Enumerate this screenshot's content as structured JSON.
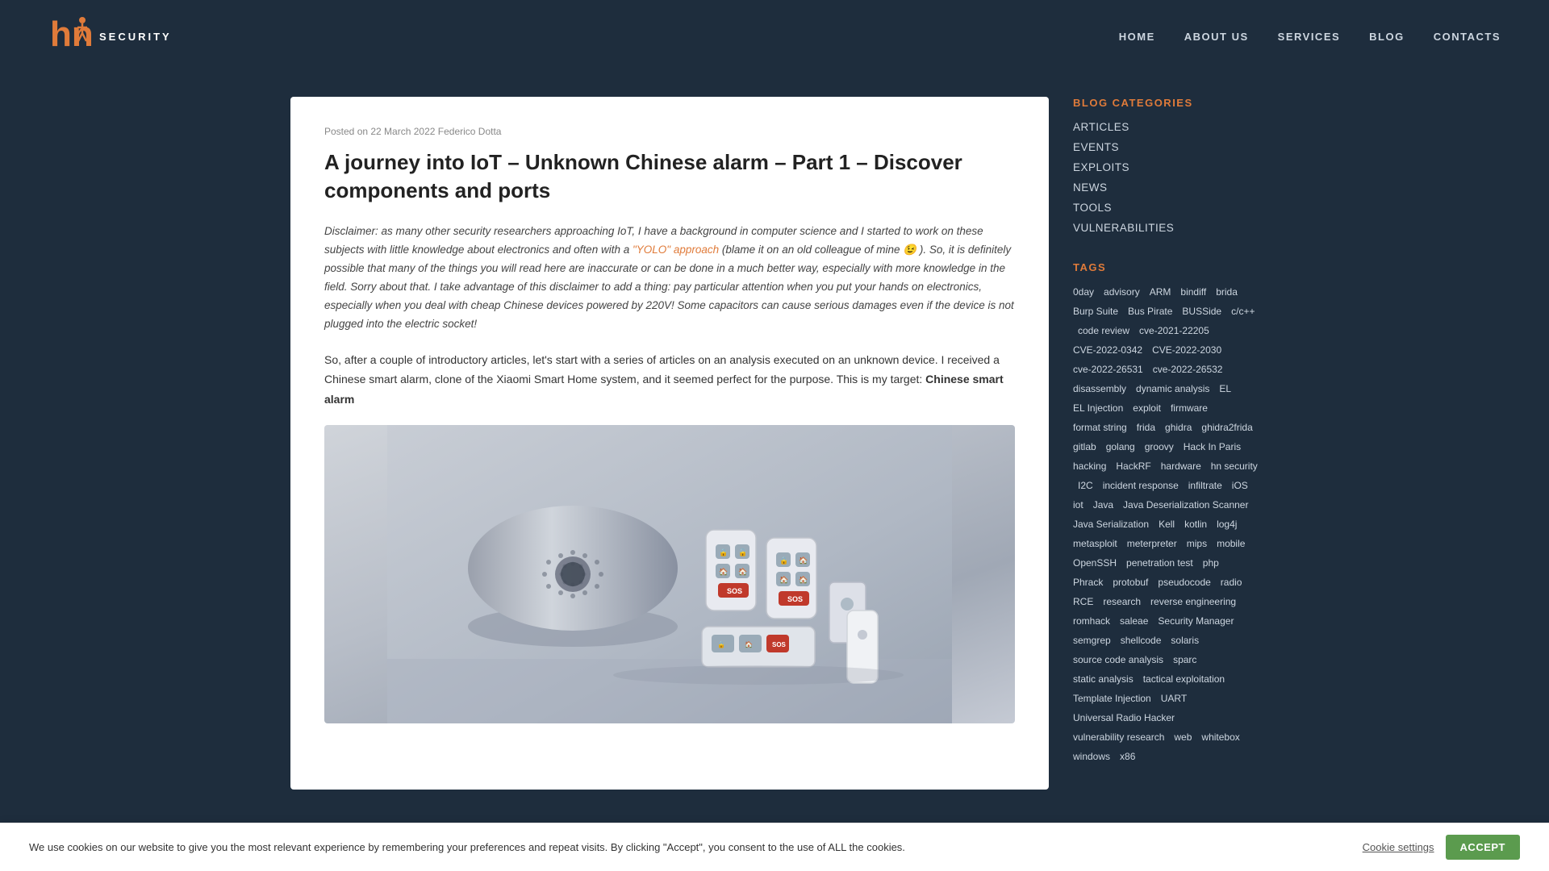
{
  "header": {
    "logo_text": "SECURITY",
    "nav": [
      {
        "label": "HOME",
        "href": "#"
      },
      {
        "label": "ABOUT US",
        "href": "#"
      },
      {
        "label": "SERVICES",
        "href": "#"
      },
      {
        "label": "BLOG",
        "href": "#"
      },
      {
        "label": "CONTACTS",
        "href": "#"
      }
    ]
  },
  "article": {
    "meta": "Posted on 22 March 2022 Federico Dotta",
    "title": "A journey into IoT – Unknown Chinese alarm – Part 1 – Discover components and ports",
    "disclaimer": "Disclaimer: as many other security researchers approaching IoT, I have a background in computer science and I started to work on these subjects with little knowledge about electronics and often with a",
    "yolo_link_text": "\"YOLO\" approach",
    "disclaimer_end": " (blame it on an old colleague of mine 😉 ). So, it is definitely possible that many of the things you will read here are inaccurate or can be done in a much better way, especially with more knowledge in the field. Sorry about that. I take advantage of this disclaimer to add a thing: pay particular attention when you put your hands on electronics, especially when you deal with cheap Chinese devices powered by 220V! Some capacitors can cause serious damages even if the device is not plugged into the electric socket!",
    "body": "So, after a couple of introductory articles, let's start with a series of articles on an analysis executed on an unknown device. I received a Chinese smart alarm, clone of the Xiaomi Smart Home system, and it seemed perfect for the purpose. This is my target:"
  },
  "sidebar": {
    "categories_heading": "BLOG CATEGORIES",
    "categories": [
      {
        "label": "ARTICLES"
      },
      {
        "label": "EVENTS"
      },
      {
        "label": "EXPLOITS"
      },
      {
        "label": "NEWS"
      },
      {
        "label": "TOOLS"
      },
      {
        "label": "VULNERABILITIES"
      }
    ],
    "tags_heading": "TAGS",
    "tags": [
      "0day",
      "advisory",
      "ARM",
      "bindiff",
      "brida",
      "Burp Suite",
      "Bus Pirate",
      "BUSSide",
      "c/c++",
      "code review",
      "cve-2021-22205",
      "CVE-2022-0342",
      "CVE-2022-2030",
      "cve-2022-26531",
      "cve-2022-26532",
      "disassembly",
      "dynamic analysis",
      "EL",
      "EL Injection",
      "exploit",
      "firmware",
      "format string",
      "frida",
      "ghidra",
      "ghidra2frida",
      "gitlab",
      "golang",
      "groovy",
      "Hack In Paris",
      "hacking",
      "HackRF",
      "hardware",
      "hn security",
      "I2C",
      "incident response",
      "infiltrate",
      "iOS",
      "iot",
      "Java",
      "Java Deserialization Scanner",
      "Java Serialization",
      "Kell",
      "kotlin",
      "log4j",
      "metasploit",
      "meterpreter",
      "mips",
      "mobile",
      "OpenSSH",
      "penetration test",
      "php",
      "Phrack",
      "protobuf",
      "pseudocode",
      "radio",
      "RCE",
      "research",
      "reverse engineering",
      "romhack",
      "saleae",
      "Security Manager",
      "semgrep",
      "shellcode",
      "solaris",
      "source code analysis",
      "sparc",
      "static analysis",
      "tactical exploitation",
      "Template Injection",
      "UART",
      "Universal Radio Hacker",
      "vulnerability research",
      "web",
      "whitebox",
      "windows",
      "x86"
    ]
  },
  "cookie": {
    "text": "We use cookies on our website to give you the most relevant experience by remembering your preferences and repeat visits. By clicking \"Accept\", you consent to the use of ALL the cookies.",
    "settings_label": "Cookie settings",
    "accept_label": "ACCEPT"
  }
}
